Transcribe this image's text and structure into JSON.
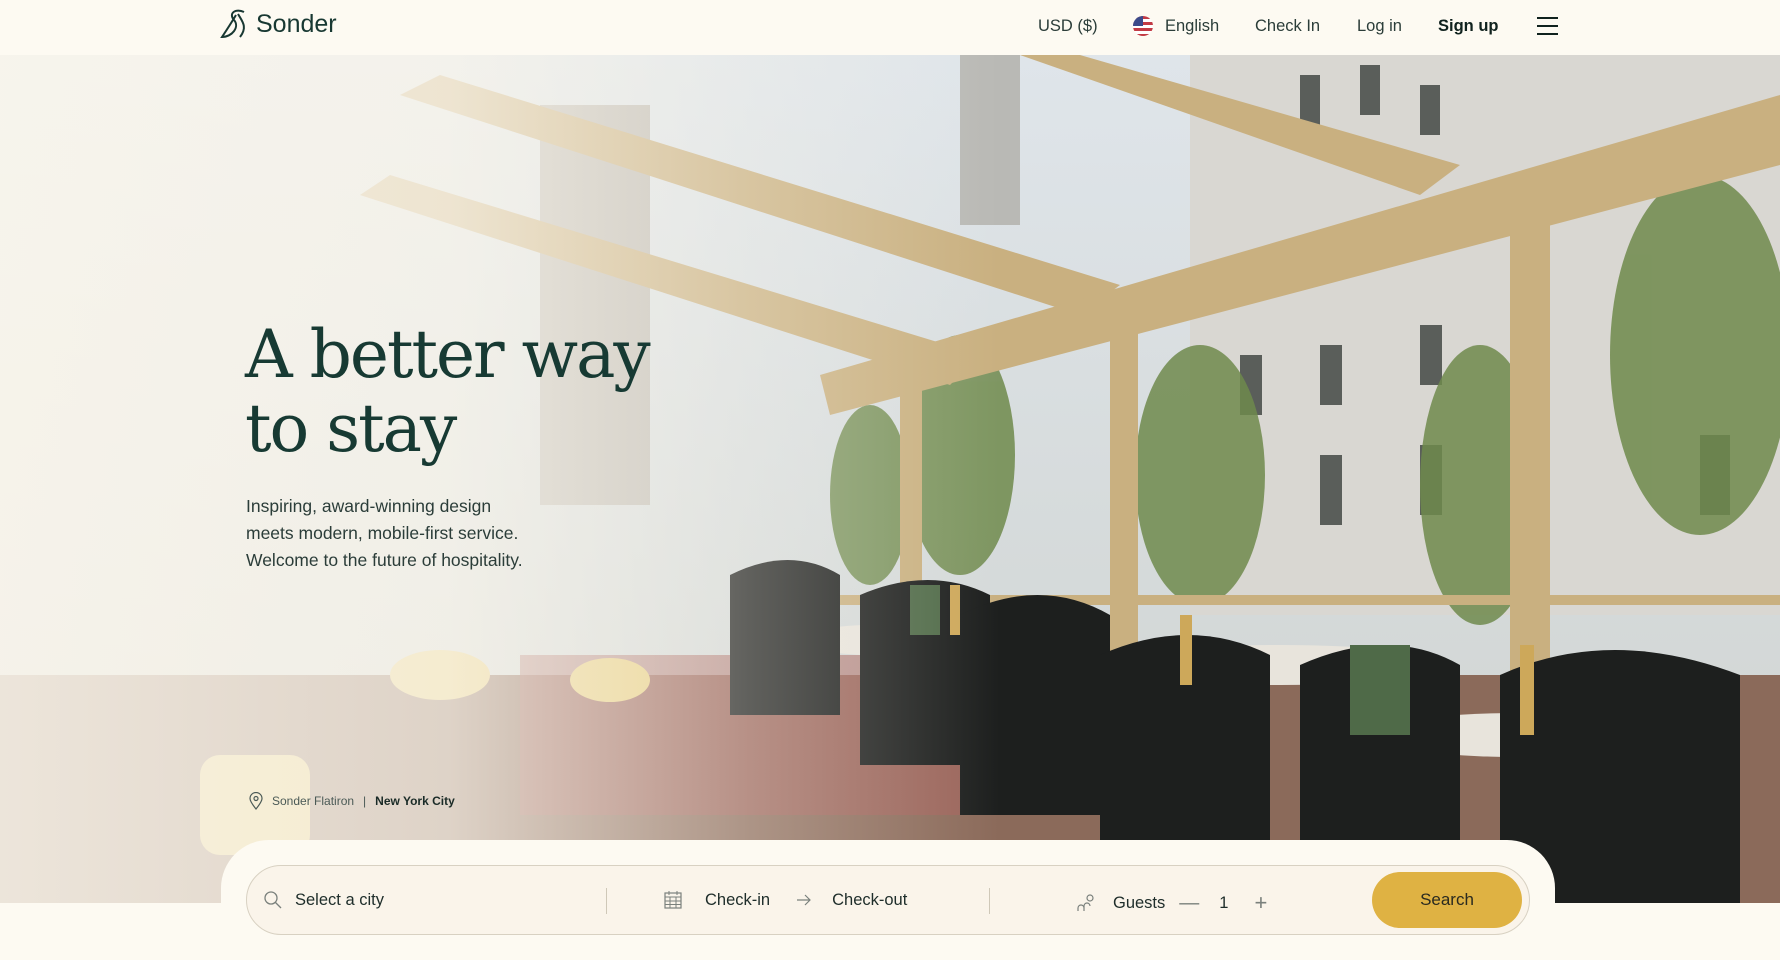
{
  "header": {
    "brand": "Sonder",
    "currency": "USD ($)",
    "language": "English",
    "check_in": "Check In",
    "log_in": "Log in",
    "sign_up": "Sign up"
  },
  "hero": {
    "title_line1": "A better way",
    "title_line2": "to stay",
    "subtitle_line1": "Inspiring, award-winning design",
    "subtitle_line2": "meets modern, mobile-first service.",
    "subtitle_line3": "Welcome to the future of hospitality.",
    "property": "Sonder Flatiron",
    "separator": "|",
    "city": "New York City"
  },
  "search": {
    "city_placeholder": "Select a city",
    "check_in": "Check-in",
    "check_out": "Check-out",
    "guests_label": "Guests",
    "guests_value": "1",
    "button": "Search"
  },
  "colors": {
    "accent": "#dfb243",
    "text": "#173a33",
    "background": "#fdfaf2"
  }
}
